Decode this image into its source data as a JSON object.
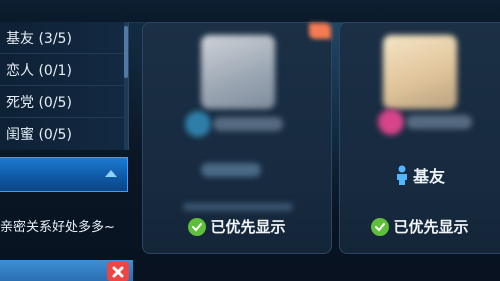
{
  "menu": {
    "items": [
      {
        "label": "基友 (3/5)"
      },
      {
        "label": "恋人 (0/1)"
      },
      {
        "label": "死党 (0/5)"
      },
      {
        "label": "闺蜜 (0/5)"
      }
    ]
  },
  "tip": {
    "text": "亲密关系好处多多~"
  },
  "cards": [
    {
      "status_label": "已优先显示"
    },
    {
      "relation_label": "基友",
      "status_label": "已优先显示"
    }
  ],
  "colors": {
    "accent_blue": "#1c7bd0",
    "check_green": "#5fbf3b",
    "close_red": "#e44444"
  },
  "icons": {
    "close": "close-icon",
    "check": "check-icon",
    "person": "person-icon",
    "arrow": "chevron-up-icon"
  }
}
